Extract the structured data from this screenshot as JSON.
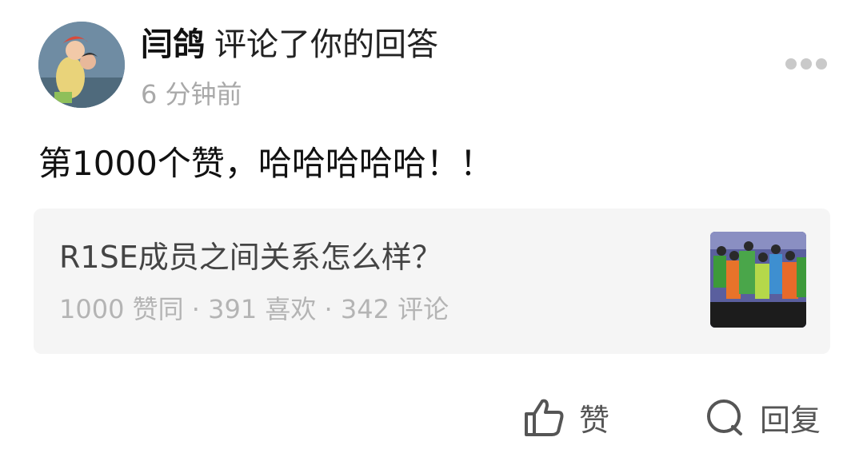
{
  "comment": {
    "username": "闫鸽",
    "action": "评论了你的回答",
    "time": "6 分钟前",
    "text": "第1000个赞，哈哈哈哈哈！！"
  },
  "quote": {
    "title": "R1SE成员之间关系怎么样？",
    "stats": "1000 赞同 · 391 喜欢 · 342 评论"
  },
  "actions": {
    "like_label": "赞",
    "reply_label": "回复"
  },
  "icons": {
    "more": "more-horizontal-icon",
    "like": "thumbs-up-icon",
    "reply": "speech-bubble-icon"
  },
  "colors": {
    "primary_text": "#111111",
    "secondary_text": "#a9a9a9",
    "card_bg": "#f5f5f5",
    "icon_gray": "#555555"
  }
}
